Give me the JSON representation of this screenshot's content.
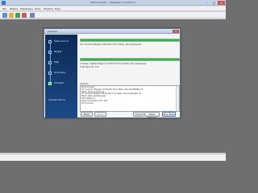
{
  "titlebar": {
    "title": "DB Converter - Database Conversion",
    "min": "–",
    "max": "□",
    "close": "×"
  },
  "menubar": {
    "items": [
      "File",
      "Wizard",
      "Databases",
      "Tools",
      "Window",
      "Help"
    ]
  },
  "dialog": {
    "title": "Convert",
    "close": "×",
    "steps": [
      "Data source",
      "Target",
      "Map",
      "Summary",
      "Convert"
    ],
    "active_step": 4,
    "convert_done": "Convert Done",
    "progress1": {
      "percent": 100,
      "line": "107 records    Elapsed: 00:00:01    From Table: dbo.employees"
    },
    "progress2": {
      "percent": 100,
      "line1": "2 tables  2 tables    Elapsed: 00:00:01    From Table: dbo.employees",
      "line2": "Total Records: 132"
    },
    "output_label": "Output",
    "output_lines": [
      "Start Convert",
      "107 records,   Elapsed: 00:00:00,   From Table: dbo.COUNTRIES,   To",
      "Table: [dbo].[countries],",
      "25 records,   Elapsed: 00:00:00,   From Table: dbo.employees,   To",
      "Table: [dbo].[employees],",
      "Total Tables: 2",
      "Total Convert Records: 132",
      "End Convert"
    ],
    "buttons": {
      "back": "Back",
      "next": "Next",
      "close": "Close",
      "save": "Save Session",
      "buy": "Buy Now"
    }
  }
}
